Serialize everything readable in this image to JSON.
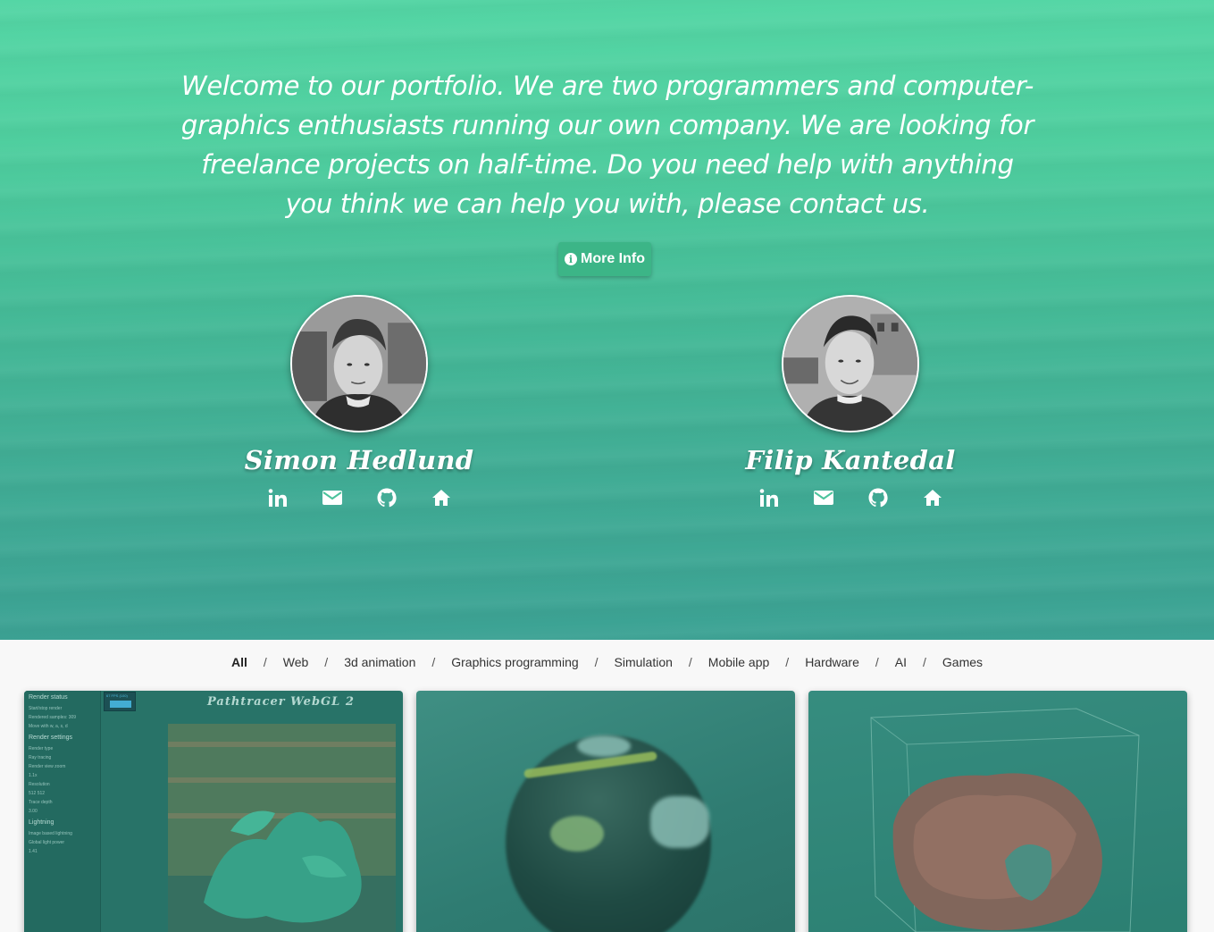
{
  "hero": {
    "intro_text": "Welcome to our portfolio. We are two programmers and computer-graphics enthusiasts running our own company. We are looking for freelance projects on half-time. Do you need help with anything you think we can help you with, please contact us.",
    "more_info_label": "More Info",
    "info_icon_glyph": "i"
  },
  "people": [
    {
      "name": "Simon Hedlund",
      "avatar": "portrait-photo",
      "socials": [
        "linkedin-icon",
        "mail-icon",
        "github-icon",
        "home-icon"
      ]
    },
    {
      "name": "Filip Kantedal",
      "avatar": "portrait-photo",
      "socials": [
        "linkedin-icon",
        "mail-icon",
        "github-icon",
        "home-icon"
      ]
    }
  ],
  "filters": {
    "separator": "/",
    "items": [
      "All",
      "Web",
      "3d animation",
      "Graphics programming",
      "Simulation",
      "Mobile app",
      "Hardware",
      "AI",
      "Games"
    ],
    "active": "All"
  },
  "projects": [
    {
      "title": "Pathtracer WebGL 2",
      "panel": {
        "fps": "67 FPS (100)",
        "render_status": "Render status",
        "start_stop": "Start/stop render",
        "rendered_samples": "Rendered samples: 309",
        "move_with": "Move with w, a, s, d",
        "render_settings": "Render settings",
        "render_type": "Render type",
        "render_type_value": "Ray tracing",
        "render_view_zoom": "Render view zoom",
        "zoom_value": "1.1x",
        "resolution": "Resolution",
        "res_w": "512",
        "res_h": "512",
        "trace_depth": "Trace depth",
        "trace_value": "3.00",
        "lightning": "Lightning",
        "ibl": "Image based lightning",
        "global_light": "Global light power",
        "global_value": "1.41"
      }
    },
    {
      "title": "",
      "subject": "blurred-ball-render"
    },
    {
      "title": "",
      "subject": "volume-render-box"
    }
  ],
  "colors": {
    "hero_top": "#54d6a5",
    "hero_bottom": "#3ca294",
    "button": "#3cb587",
    "page_bg": "#f8f8f8"
  }
}
